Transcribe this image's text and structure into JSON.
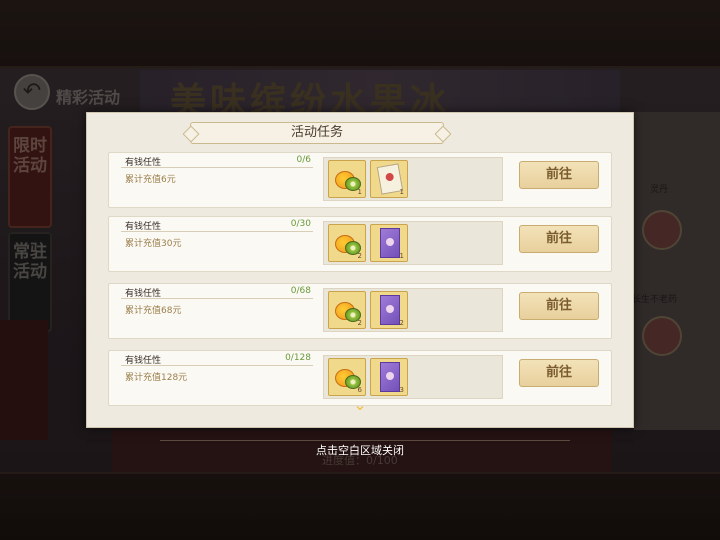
{
  "background": {
    "screen_title": "精彩活动",
    "banner_text": "美味缤纷水果冰",
    "side_tabs": [
      {
        "label": "限时活动"
      },
      {
        "label": "常驻活动"
      }
    ],
    "right_panel": {
      "label_1": "灵丹",
      "label_2": "长生不老药"
    },
    "progress_text": "进度值：0/100"
  },
  "modal": {
    "title": "活动任务",
    "tasks": [
      {
        "name": "有钱任性",
        "progress": "0/6",
        "description": "累计充值6元",
        "rewards": [
          {
            "icon": "fruit-icon",
            "qty": "1"
          },
          {
            "icon": "ticket-icon",
            "qty": "1"
          }
        ],
        "button": "前往"
      },
      {
        "name": "有钱任性",
        "progress": "0/30",
        "description": "累计充值30元",
        "rewards": [
          {
            "icon": "fruit-icon",
            "qty": "2"
          },
          {
            "icon": "purple-card-icon",
            "qty": "1"
          }
        ],
        "button": "前往"
      },
      {
        "name": "有钱任性",
        "progress": "0/68",
        "description": "累计充值68元",
        "rewards": [
          {
            "icon": "fruit-icon",
            "qty": "2"
          },
          {
            "icon": "purple-card-icon",
            "qty": "2"
          }
        ],
        "button": "前往"
      },
      {
        "name": "有钱任性",
        "progress": "0/128",
        "description": "累计充值128元",
        "rewards": [
          {
            "icon": "fruit-icon",
            "qty": "6"
          },
          {
            "icon": "purple-card-icon",
            "qty": "3"
          }
        ],
        "button": "前往"
      }
    ],
    "close_hint": "点击空白区域关闭"
  },
  "colors": {
    "progress_green": "#6a9a3a",
    "desc_gold": "#9a7e4a",
    "button_text": "#7a5c2e"
  }
}
